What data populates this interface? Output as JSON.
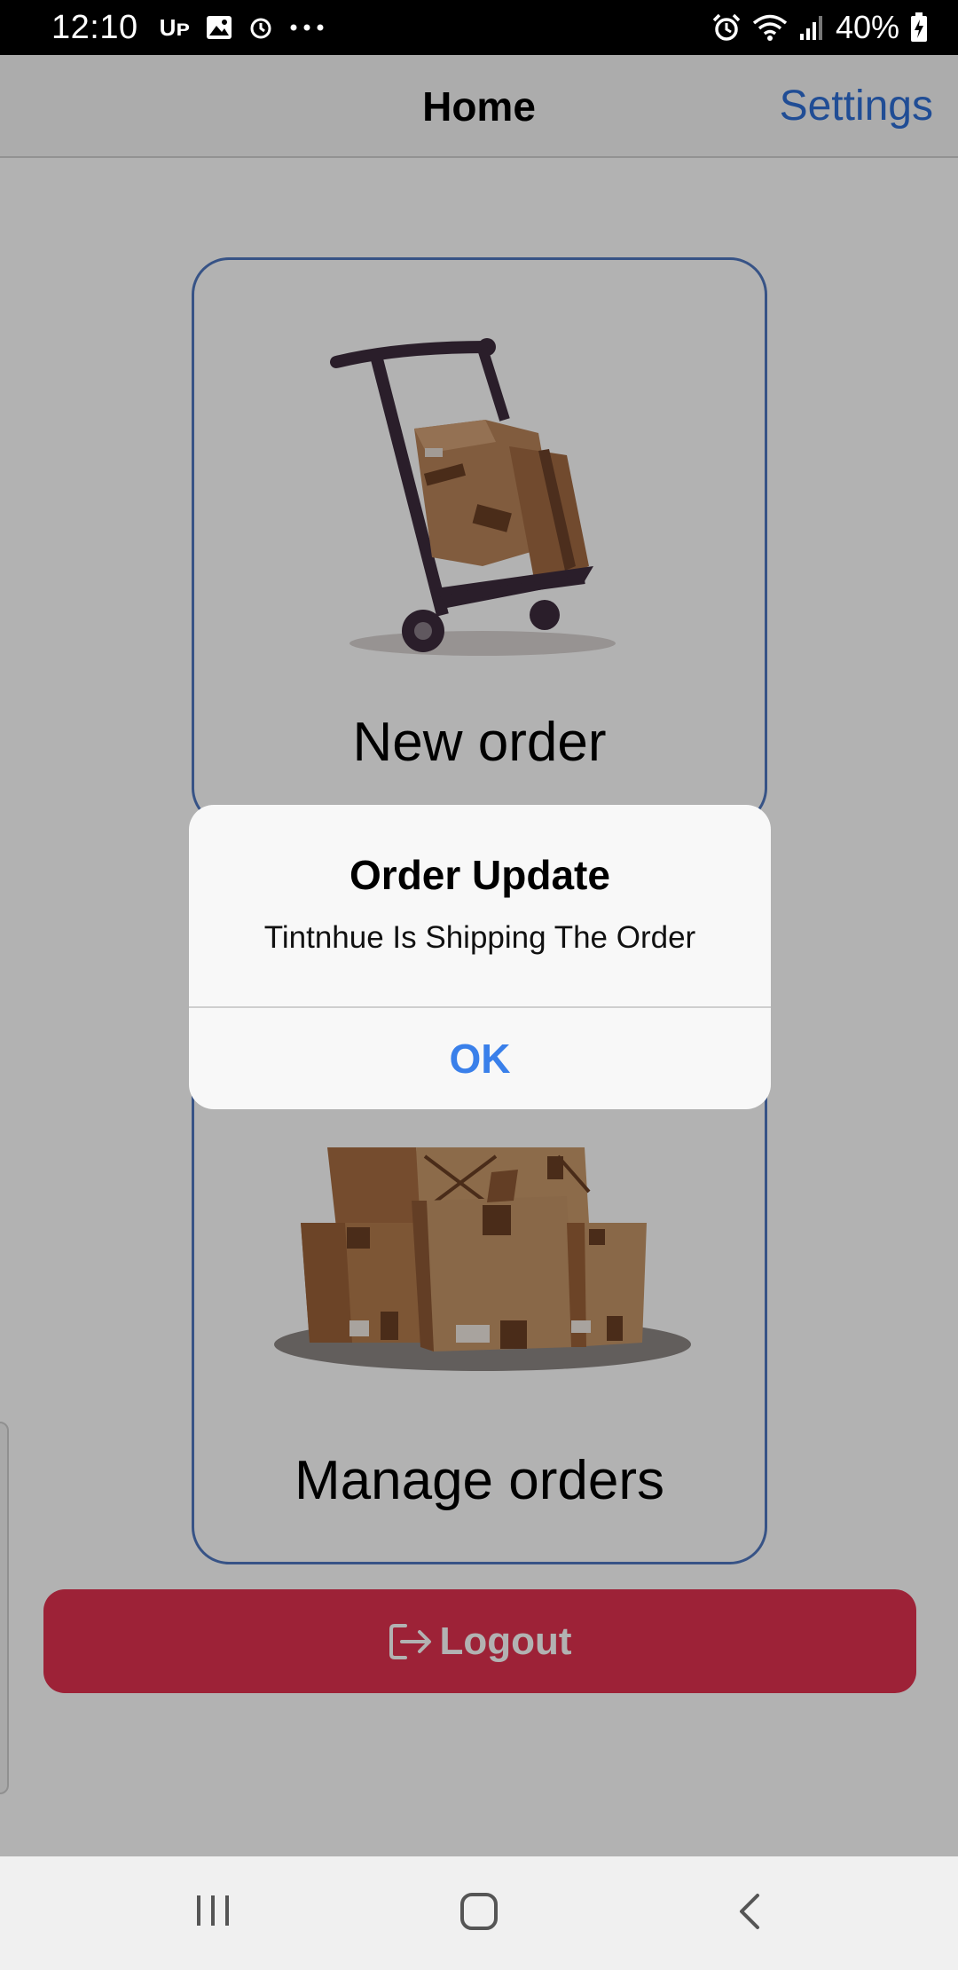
{
  "status_bar": {
    "time": "12:10",
    "left_icons": [
      "uber-icon",
      "image-icon",
      "alarm-clock-icon",
      "more-dots-icon"
    ],
    "right_icons": [
      "alarm-icon",
      "wifi-icon",
      "signal-icon",
      "battery-icon"
    ],
    "battery": "40%"
  },
  "nav": {
    "title": "Home",
    "settings_label": "Settings"
  },
  "cards": {
    "new_order": {
      "label": "New order",
      "icon": "hand-truck-boxes-icon"
    },
    "manage_orders": {
      "label": "Manage orders",
      "icon": "box-stack-icon"
    }
  },
  "logout": {
    "label": "Logout",
    "icon": "logout-icon"
  },
  "dialog": {
    "title": "Order Update",
    "message": "Tintnhue Is Shipping The Order",
    "ok_label": "OK"
  },
  "system_nav": {
    "icons": [
      "recent-apps-icon",
      "home-icon",
      "back-icon"
    ]
  },
  "colors": {
    "accent_blue": "#2f6fd6",
    "card_border": "#4f77c1",
    "logout_red": "#e1324f",
    "dialog_ok": "#3a80ea"
  }
}
